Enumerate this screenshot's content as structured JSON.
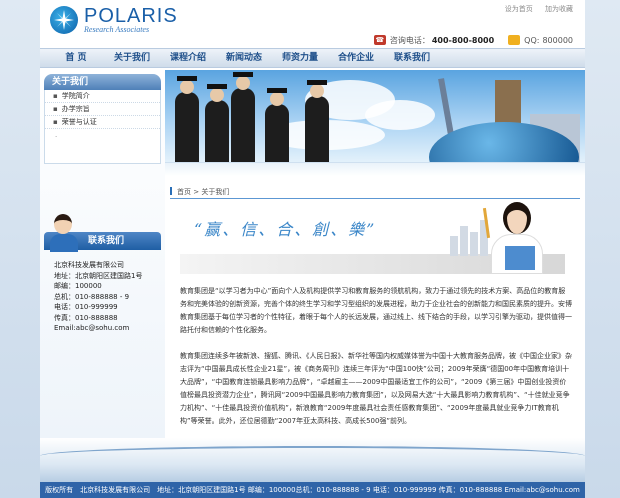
{
  "header": {
    "logo_name": "POLARIS",
    "logo_sub": "Research Associates",
    "links": [
      "设为首页",
      "加为收藏"
    ],
    "phone_label": "咨询电话：",
    "phone_number": "400-800-8000",
    "qq_label": "QQ:",
    "qq_number": "800000"
  },
  "nav": {
    "items": [
      "首 页",
      "关于我们",
      "课程介绍",
      "新闻动态",
      "师资力量",
      "合作企业",
      "联系我们"
    ]
  },
  "sidebar": {
    "title": "关于我们",
    "items": [
      "学院简介",
      "办学宗旨",
      "荣誉与认证"
    ],
    "contact_title": "联系我们",
    "contact_lines": [
      "北京科技发展有限公司",
      "地址：北京朝阳区建国路1号",
      "邮编：100000",
      "总机：010-888888 - 9",
      "电话：010-999999",
      "传真：010-888888",
      "Email:abc@sohu.com"
    ]
  },
  "breadcrumb": {
    "home": "首页",
    "sep": " > ",
    "current": "关于我们"
  },
  "slogan": "“赢、信、合、創、樂”",
  "content": {
    "paragraphs": [
      "教育集团是“以学习者为中心”面向个人及机构提供学习和教育服务的领航机构，致力于通过领先的技术方案、高品位的教育服务和完美体验的创新资源，完善个体的终生学习和学习型组织的发展进程，助力于企业社会的创新能力和国民素质的提升。安博教育集团基于每位学习者的个性特征，着眼于每个人的长远发展，通过线上、线下结合的手段，以学习引擎为驱动，提供值得一路托付和信赖的个性化服务。",
      "教育集团连续多年被新浪、搜狐、腾讯、《人民日报》、新华社等国内权威媒体誉为中国十大教育服务品牌，被《中国企业家》杂志评为“中国最具成长性企业21星”，被《商务周刊》连续三年评为“中国100快”公司；2009年荣膺“德国00年中国教育培训十大品牌”，“中国教育连锁最具影响力品牌”，“卓越雇主——2009中国最适宜工作的公司”，“2009《第三届》中国创业投资价值榜最具投资潜力企业”，腾讯网“2009中国最具影响力教育集团”，以及网易大选“十大最具影响力教育机构”、“十佳就业竞争力机构”、“十佳最具投资价值机构”，新浪教育“2009年度最具社会责任感教育集团”、“2009年度最具就业竞争力IT教育机构”等荣誉。此外，还位居德勤“2007年亚太高科技、高成长500强”前列。"
    ]
  },
  "footer": {
    "text": "版权所有　北京科技发展有限公司　地址：北京朝阳区建国路1号 邮编：100000总机：010-888888 - 9 电话：010-999999 传真：010-888888 Email:abc@sohu.com"
  }
}
